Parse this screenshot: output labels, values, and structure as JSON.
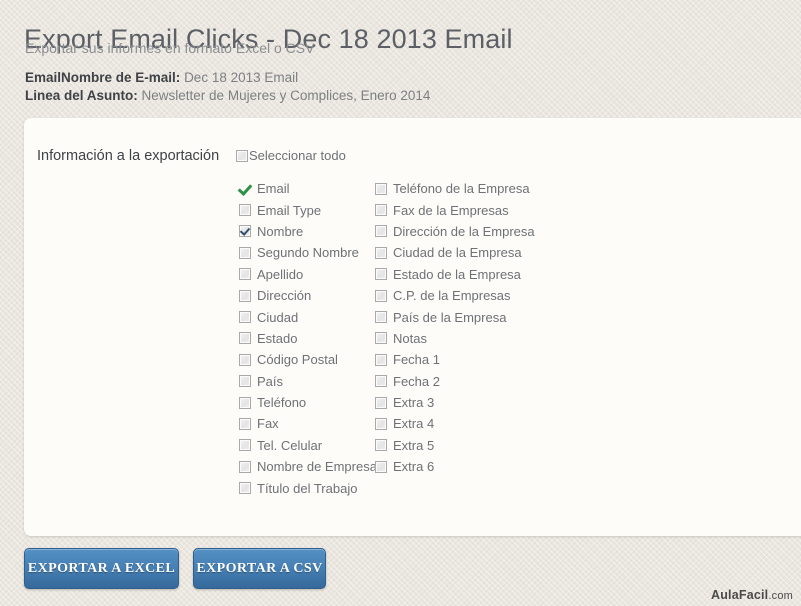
{
  "header": {
    "title": "Export Email Clicks - Dec 18 2013 Email",
    "subtitle": "Exportar sus informes en formato Excel o CSV",
    "info": [
      {
        "label": "EmailNombre de E-mail:",
        "value": "Dec 18 2013 Email"
      },
      {
        "label": "Linea del Asunto:",
        "value": "Newsletter de Mujeres y Complices, Enero 2014"
      }
    ]
  },
  "panel": {
    "section_label": "Información a la exportación",
    "select_all": {
      "label": "Seleccionar todo",
      "state": "unchecked"
    },
    "column_1": [
      {
        "label": "Email",
        "state": "tick"
      },
      {
        "label": "Email Type",
        "state": "unchecked"
      },
      {
        "label": "Nombre",
        "state": "checked"
      },
      {
        "label": "Segundo Nombre",
        "state": "unchecked"
      },
      {
        "label": "Apellido",
        "state": "unchecked"
      },
      {
        "label": "Dirección",
        "state": "unchecked"
      },
      {
        "label": "Ciudad",
        "state": "unchecked"
      },
      {
        "label": "Estado",
        "state": "unchecked"
      },
      {
        "label": "Código Postal",
        "state": "unchecked"
      },
      {
        "label": "País",
        "state": "unchecked"
      },
      {
        "label": "Teléfono",
        "state": "unchecked"
      },
      {
        "label": "Fax",
        "state": "unchecked"
      },
      {
        "label": "Tel. Celular",
        "state": "unchecked"
      },
      {
        "label": "Nombre de Empresa",
        "state": "unchecked"
      },
      {
        "label": "Título del Trabajo",
        "state": "unchecked"
      }
    ],
    "column_2": [
      {
        "label": "Teléfono de la Empresa",
        "state": "unchecked"
      },
      {
        "label": "Fax de la Empresas",
        "state": "unchecked"
      },
      {
        "label": "Dirección de la Empresa",
        "state": "unchecked"
      },
      {
        "label": "Ciudad de la Empresa",
        "state": "unchecked"
      },
      {
        "label": "Estado de la Empresa",
        "state": "unchecked"
      },
      {
        "label": "C.P. de la Empresas",
        "state": "unchecked"
      },
      {
        "label": "País de la Empresa",
        "state": "unchecked"
      },
      {
        "label": "Notas",
        "state": "unchecked"
      },
      {
        "label": "Fecha 1",
        "state": "unchecked"
      },
      {
        "label": "Fecha 2",
        "state": "unchecked"
      },
      {
        "label": "Extra 3",
        "state": "unchecked"
      },
      {
        "label": "Extra 4",
        "state": "unchecked"
      },
      {
        "label": "Extra 5",
        "state": "unchecked"
      },
      {
        "label": "Extra 6",
        "state": "unchecked"
      }
    ]
  },
  "buttons": {
    "export_excel": "EXPORTAR A EXCEL",
    "export_csv": "EXPORTAR A CSV"
  },
  "watermark": {
    "name": "AulaFacil",
    "domain": ".com"
  },
  "colors": {
    "page_background": "#ebe7e0",
    "panel_background": "#fdfcf9",
    "title": "#5c6066",
    "subtitle": "#8a8d91",
    "label": "#6e7175",
    "button_blue": "#4781b5",
    "tick_green": "#2e9146"
  }
}
